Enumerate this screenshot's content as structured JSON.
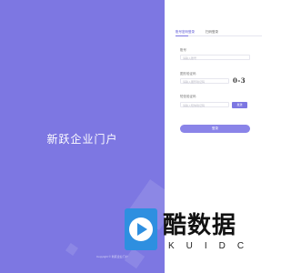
{
  "brand": {
    "title": "新跃企业门户"
  },
  "tabs": [
    {
      "label": "账号密码登录"
    },
    {
      "label": "扫码登录"
    }
  ],
  "form": {
    "username": {
      "label": "账号",
      "placeholder": "请输入账号"
    },
    "image_code": {
      "label": "图形验证码",
      "placeholder": "请输入图形验证码",
      "captcha": "0-3"
    },
    "sms_code": {
      "label": "短信验证码",
      "placeholder": "请输入短信验证码",
      "send_label": "发送"
    },
    "submit_label": "登录"
  },
  "footer": {
    "text": "Copyright © 新跃企业门户"
  },
  "watermark": {
    "cn": "酷数据",
    "en": "KUIDC"
  },
  "colors": {
    "primary": "#7d77e2",
    "button": "#8a84e8"
  }
}
